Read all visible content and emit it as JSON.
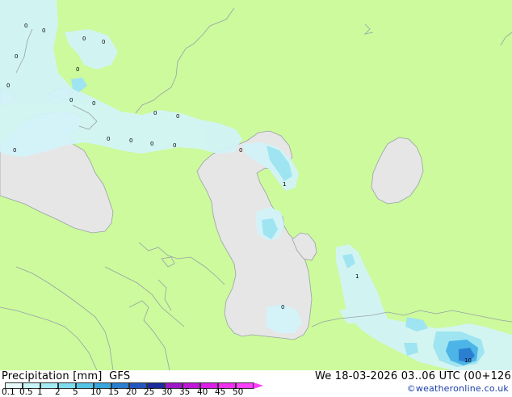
{
  "header": {
    "title_label": "Precipitation [mm]",
    "model": "GFS",
    "valid_time": "We 18-03-2026 03..06 UTC (00+126",
    "credit": "©weatheronline.co.uk"
  },
  "scale": {
    "labels": [
      "0.1",
      "0.5",
      "1",
      "2",
      "5",
      "10",
      "15",
      "20",
      "25",
      "30",
      "35",
      "40",
      "45",
      "50"
    ],
    "colors": [
      "#e6fcfc",
      "#c8f5f8",
      "#a4ecf4",
      "#7ddcee",
      "#54c5e7",
      "#38a6dd",
      "#2b7fd0",
      "#2456c0",
      "#1c2b9c",
      "#9c18c8",
      "#c018d8",
      "#dc20e8",
      "#f030f0",
      "#ff40ff"
    ]
  },
  "map": {
    "land_color": "#ccfa9c",
    "water_color": "#e6e6e6",
    "precip_light": "#d2f4fa",
    "precip_mid": "#9fe4f1",
    "precip_heavy": "#4cb4e6",
    "point_labels": [
      "0",
      "0",
      "0",
      "0",
      "0",
      "0",
      "0",
      "0",
      "0",
      "0",
      "0",
      "0",
      "0",
      "0",
      "0",
      "0",
      "1",
      "1",
      "10",
      "0",
      "0"
    ]
  }
}
